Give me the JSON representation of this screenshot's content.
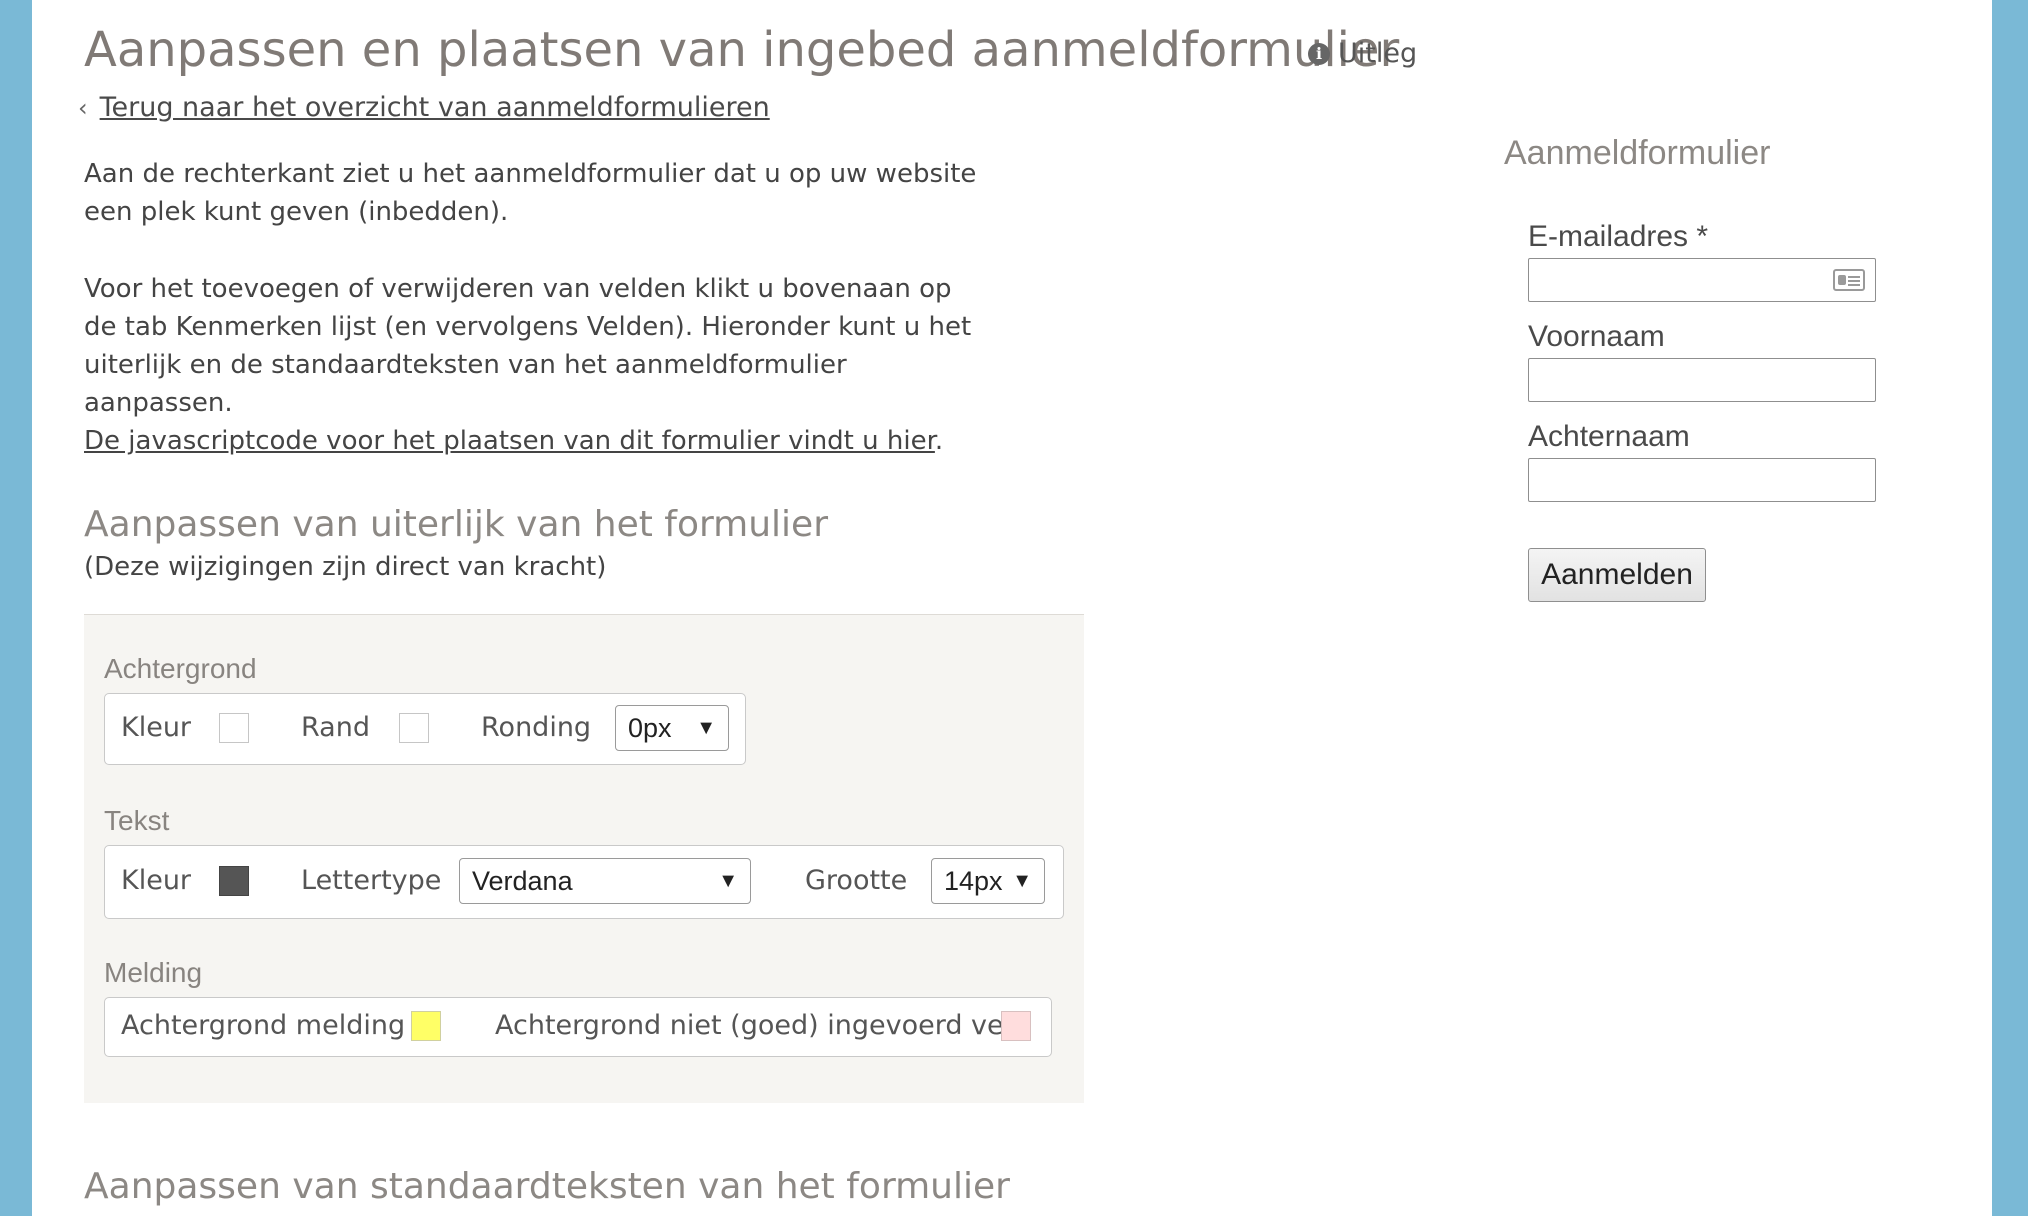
{
  "header": {
    "title": "Aanpassen en plaatsen van ingebed aanmeldformulier",
    "help_label": "Uitleg",
    "back_link": "Terug naar het overzicht van aanmeldformulieren"
  },
  "intro": {
    "paragraph1": "Aan de rechterkant ziet u het aanmeldformulier dat u op uw website een plek kunt geven (inbedden).",
    "paragraph2": "Voor het toevoegen of verwijderen van velden klikt u bovenaan op de tab Kenmerken lijst (en vervolgens Velden). Hieronder kunt u het uiterlijk en de standaardteksten van het aanmeldformulier aanpassen.",
    "js_link": "De javascriptcode voor het plaatsen van dit formulier vindt u hier",
    "js_link_suffix": "."
  },
  "appearance": {
    "title": "Aanpassen van uiterlijk van het formulier",
    "subtitle": "(Deze wijzigingen zijn direct van kracht)",
    "background": {
      "label": "Achtergrond",
      "color_label": "Kleur",
      "color_value": "#ffffff",
      "border_label": "Rand",
      "border_value": "#ffffff",
      "rounding_label": "Ronding",
      "rounding_value": "0px"
    },
    "text": {
      "label": "Tekst",
      "color_label": "Kleur",
      "color_value": "#555555",
      "font_label": "Lettertype",
      "font_value": "Verdana",
      "size_label": "Grootte",
      "size_value": "14px"
    },
    "message": {
      "label": "Melding",
      "bg_label": "Achtergrond melding",
      "bg_value": "#ffff66",
      "invalid_label": "Achtergrond niet (goed) ingevoerd veld",
      "invalid_value": "#ffdddd"
    }
  },
  "texts_section": {
    "title": "Aanpassen van standaardteksten van het formulier"
  },
  "preview_form": {
    "title": "Aanmeldformulier",
    "email_label": "E-mailadres *",
    "firstname_label": "Voornaam",
    "lastname_label": "Achternaam",
    "submit_label": "Aanmelden"
  },
  "colors": {
    "frame": "#7ab9d6",
    "panel": "#f6f5f2"
  }
}
